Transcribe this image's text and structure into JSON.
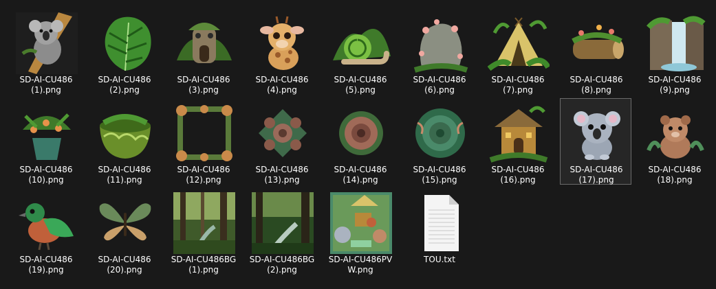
{
  "files": [
    {
      "line1": "SD-AI-CU486",
      "line2": "(1).png",
      "icon": "koala-on-branch-icon"
    },
    {
      "line1": "SD-AI-CU486",
      "line2": "(2).png",
      "icon": "monstera-leaf-icon"
    },
    {
      "line1": "SD-AI-CU486",
      "line2": "(3).png",
      "icon": "jungle-hut-icon"
    },
    {
      "line1": "SD-AI-CU486",
      "line2": "(4).png",
      "icon": "baby-giraffe-icon"
    },
    {
      "line1": "SD-AI-CU486",
      "line2": "(5).png",
      "icon": "snail-icon"
    },
    {
      "line1": "SD-AI-CU486",
      "line2": "(6).png",
      "icon": "flowered-rock-icon"
    },
    {
      "line1": "SD-AI-CU486",
      "line2": "(7).png",
      "icon": "teepee-tent-icon"
    },
    {
      "line1": "SD-AI-CU486",
      "line2": "(8).png",
      "icon": "mossy-log-icon"
    },
    {
      "line1": "SD-AI-CU486",
      "line2": "(9).png",
      "icon": "waterfall-icon"
    },
    {
      "line1": "SD-AI-CU486",
      "line2": "(10).png",
      "icon": "flower-pot-icon"
    },
    {
      "line1": "SD-AI-CU486",
      "line2": "(11).png",
      "icon": "green-bowl-icon"
    },
    {
      "line1": "SD-AI-CU486",
      "line2": "(12).png",
      "icon": "leaf-frame-icon"
    },
    {
      "line1": "SD-AI-CU486",
      "line2": "(13).png",
      "icon": "rose-cluster-icon"
    },
    {
      "line1": "SD-AI-CU486",
      "line2": "(14).png",
      "icon": "rose-icon"
    },
    {
      "line1": "SD-AI-CU486",
      "line2": "(15).png",
      "icon": "green-rose-icon"
    },
    {
      "line1": "SD-AI-CU486",
      "line2": "(16).png",
      "icon": "treehouse-icon"
    },
    {
      "line1": "SD-AI-CU486",
      "line2": "(17).png",
      "icon": "sitting-koala-icon",
      "selected": true
    },
    {
      "line1": "SD-AI-CU486",
      "line2": "(18).png",
      "icon": "bear-cub-icon"
    },
    {
      "line1": "SD-AI-CU486",
      "line2": "(19).png",
      "icon": "bird-icon"
    },
    {
      "line1": "SD-AI-CU486",
      "line2": "(20).png",
      "icon": "butterfly-icon"
    },
    {
      "line1": "SD-AI-CU486BG",
      "line2": "(1).png",
      "icon": "forest-background-icon"
    },
    {
      "line1": "SD-AI-CU486BG",
      "line2": "(2).png",
      "icon": "forest-stream-icon"
    },
    {
      "line1": "SD-AI-CU486PV",
      "line2": "W.png",
      "icon": "preview-collage-icon"
    },
    {
      "line1": "TOU.txt",
      "line2": "",
      "icon": "text-document-icon"
    }
  ],
  "colors": {
    "background": "#191919",
    "selection_border": "#6b6b6b",
    "label": "#ffffff"
  }
}
